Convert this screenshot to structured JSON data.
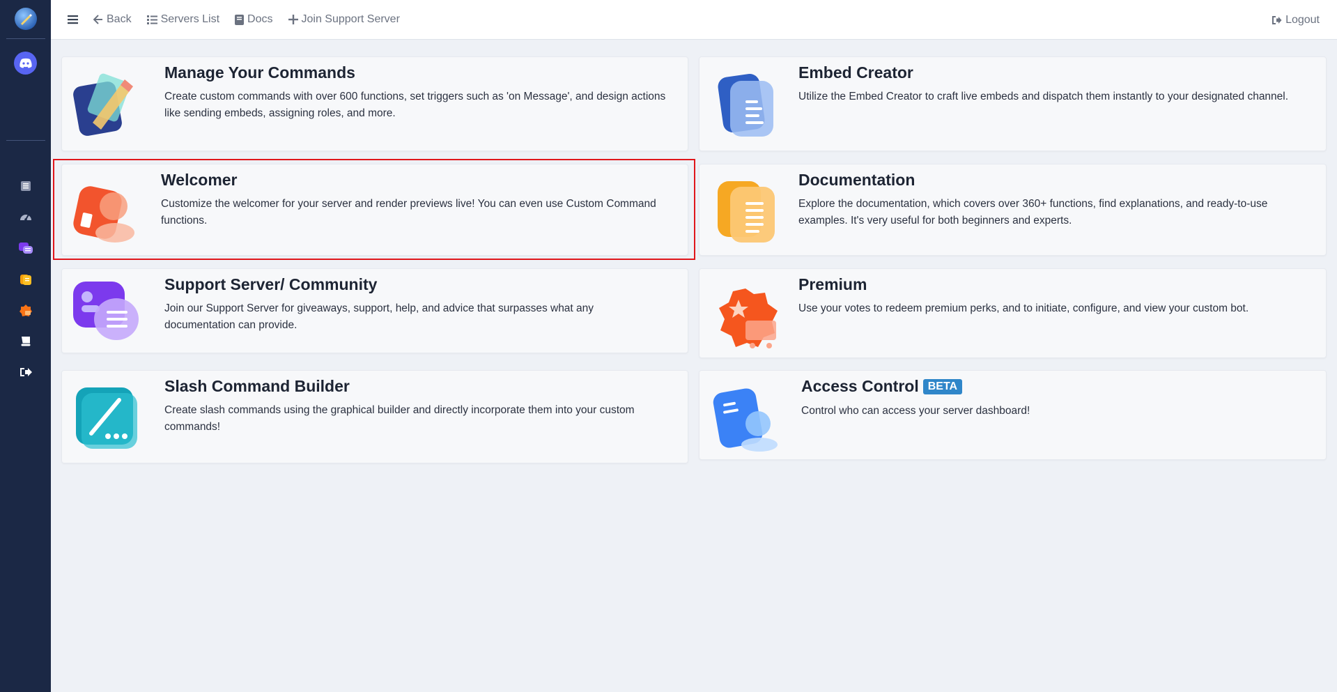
{
  "topbar": {
    "back": "Back",
    "servers_list": "Servers List",
    "docs": "Docs",
    "join_support": "Join Support Server",
    "logout": "Logout"
  },
  "cards": {
    "commands": {
      "title": "Manage Your Commands",
      "description": "Create custom commands with over 600 functions, set triggers such as 'on Message', and design actions like sending embeds, assigning roles, and more."
    },
    "embed": {
      "title": "Embed Creator",
      "description": "Utilize the Embed Creator to craft live embeds and dispatch them instantly to your designated channel."
    },
    "welcomer": {
      "title": "Welcomer",
      "description": "Customize the welcomer for your server and render previews live! You can even use Custom Command functions."
    },
    "documentation": {
      "title": "Documentation",
      "description": "Explore the documentation, which covers over 360+ functions, find explanations, and ready-to-use examples. It's very useful for both beginners and experts."
    },
    "support": {
      "title": "Support Server/ Community",
      "description": "Join our Support Server for giveaways, support, help, and advice that surpasses what any documentation can provide."
    },
    "premium": {
      "title": "Premium",
      "description": "Use your votes to redeem premium perks, and to initiate, configure, and view your custom bot."
    },
    "slash": {
      "title": "Slash Command Builder",
      "description": "Create slash commands using the graphical builder and directly incorporate them into your custom commands!"
    },
    "access": {
      "title": "Access Control",
      "badge": "BETA",
      "description": "Control who can access your server dashboard!"
    }
  },
  "colors": {
    "sidebar": "#1b2845",
    "highlight": "#e0161b",
    "beta_badge": "#2f86c9",
    "discord": "#5865f2"
  }
}
